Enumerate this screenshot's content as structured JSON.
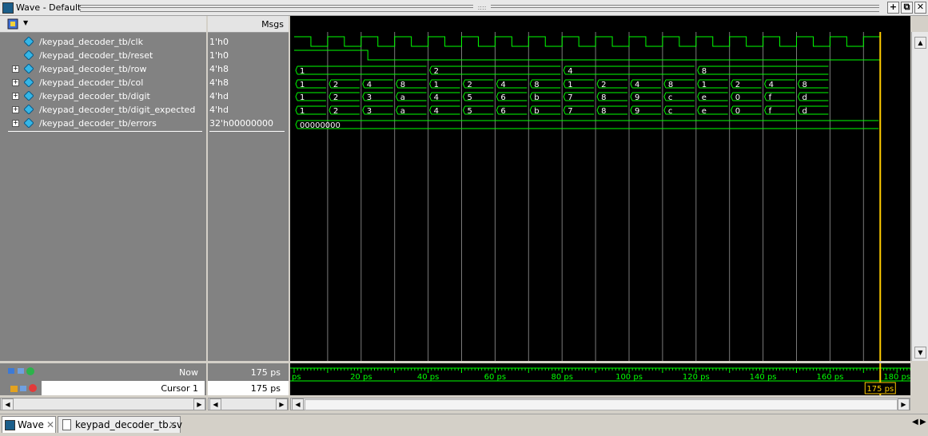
{
  "window": {
    "title": "Wave - Default",
    "buttons": [
      "+",
      "⧉",
      "✕"
    ]
  },
  "columns": {
    "msgs": "Msgs"
  },
  "signals": [
    {
      "name": "/keypad_decoder_tb/clk",
      "value": "1'h0",
      "expandable": false
    },
    {
      "name": "/keypad_decoder_tb/reset",
      "value": "1'h0",
      "expandable": false
    },
    {
      "name": "/keypad_decoder_tb/row",
      "value": "4'h8",
      "expandable": true
    },
    {
      "name": "/keypad_decoder_tb/col",
      "value": "4'h8",
      "expandable": true
    },
    {
      "name": "/keypad_decoder_tb/digit",
      "value": "4'hd",
      "expandable": true
    },
    {
      "name": "/keypad_decoder_tb/digit_expected",
      "value": "4'hd",
      "expandable": true
    },
    {
      "name": "/keypad_decoder_tb/errors",
      "value": "32'h00000000",
      "expandable": true
    }
  ],
  "waves": {
    "row_values": [
      "1",
      "2",
      "4",
      "8"
    ],
    "col_values": [
      "1",
      "2",
      "4",
      "8",
      "1",
      "2",
      "4",
      "8",
      "1",
      "2",
      "4",
      "8",
      "1",
      "2",
      "4",
      "8"
    ],
    "digit_values": [
      "1",
      "2",
      "3",
      "a",
      "4",
      "5",
      "6",
      "b",
      "7",
      "8",
      "9",
      "c",
      "e",
      "0",
      "f",
      "d"
    ],
    "digit_expected_values": [
      "1",
      "2",
      "3",
      "a",
      "4",
      "5",
      "6",
      "b",
      "7",
      "8",
      "9",
      "c",
      "e",
      "0",
      "f",
      "d"
    ],
    "errors_value": "00000000"
  },
  "footer": {
    "now_label": "Now",
    "now_value": "175 ps",
    "cursor_label": "Cursor 1",
    "cursor_value": "175 ps",
    "cursor_flag": "175 ps",
    "time_ticks": [
      "ps",
      "20 ps",
      "40 ps",
      "60 ps",
      "80 ps",
      "100 ps",
      "120 ps",
      "140 ps",
      "160 ps",
      "180 ps"
    ]
  },
  "tabs": [
    {
      "label": "Wave",
      "active": true
    },
    {
      "label": "keypad_decoder_tb.sv",
      "active": false
    }
  ],
  "colors": {
    "wave_green": "#00ff00",
    "cursor": "#ffcc00",
    "grid": "#7a7a7a",
    "bg": "#000000"
  }
}
